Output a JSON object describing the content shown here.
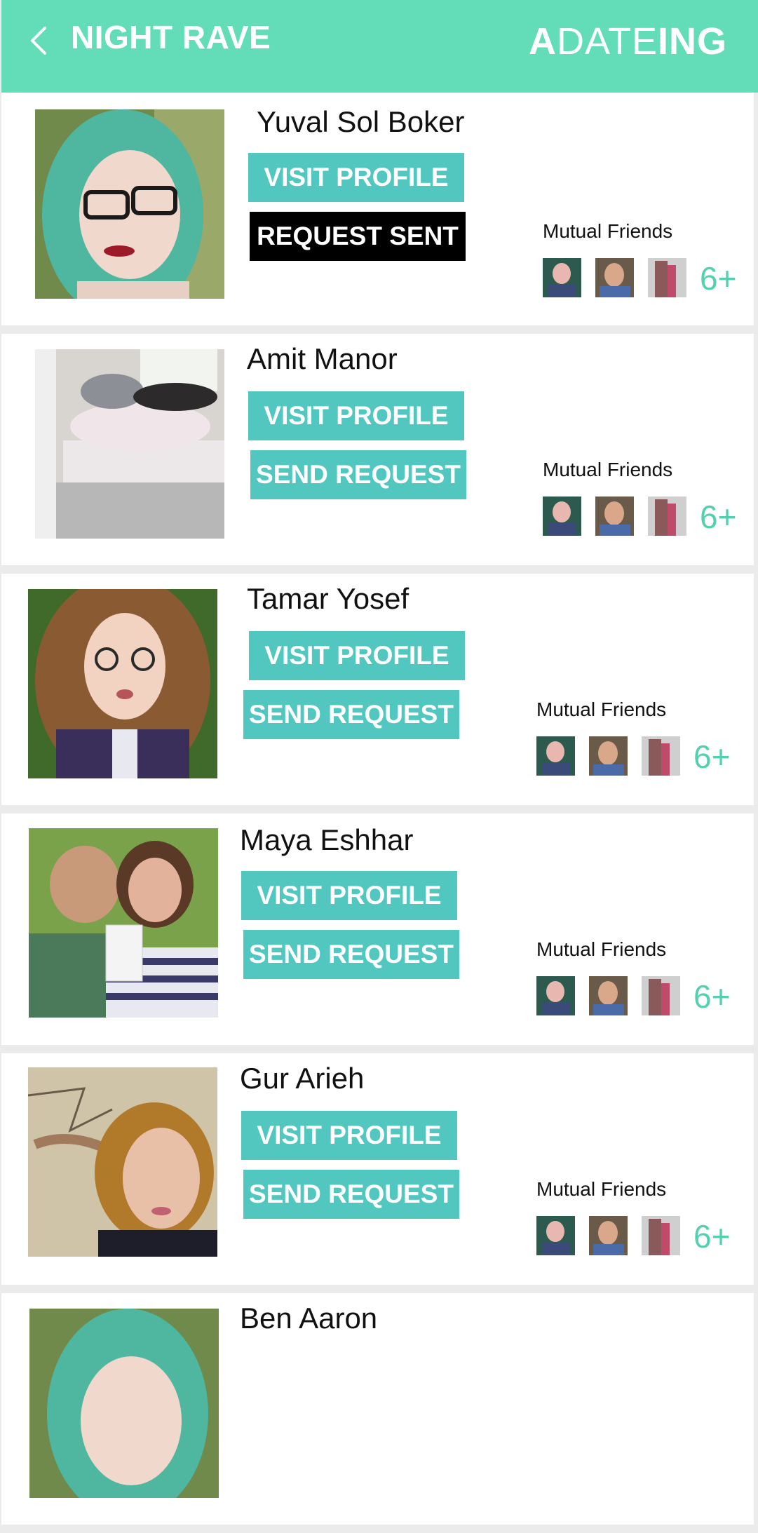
{
  "header": {
    "back_icon": "chevron-left-icon",
    "title": "NIGHT RAVE",
    "brand_a": "A",
    "brand_date": "DATE",
    "brand_ing": "ING"
  },
  "people": [
    {
      "name": "Yuval Sol Boker",
      "visit_label": "VISIT PROFILE",
      "request_label": "REQUEST SENT",
      "request_state": "sent",
      "mutual_label": "Mutual Friends",
      "mutual_more": "6+"
    },
    {
      "name": "Amit Manor",
      "visit_label": "VISIT PROFILE",
      "request_label": "SEND REQUEST",
      "request_state": "send",
      "mutual_label": "Mutual Friends",
      "mutual_more": "6+"
    },
    {
      "name": "Tamar Yosef",
      "visit_label": "VISIT PROFILE",
      "request_label": "SEND REQUEST",
      "request_state": "send",
      "mutual_label": "Mutual Friends",
      "mutual_more": "6+"
    },
    {
      "name": "Maya Eshhar",
      "visit_label": "VISIT PROFILE",
      "request_label": "SEND REQUEST",
      "request_state": "send",
      "mutual_label": "Mutual Friends",
      "mutual_more": "6+"
    },
    {
      "name": "Gur Arieh",
      "visit_label": "VISIT PROFILE",
      "request_label": "SEND REQUEST",
      "request_state": "send",
      "mutual_label": "Mutual Friends",
      "mutual_more": "6+"
    },
    {
      "name": "Ben Aaron"
    }
  ],
  "colors": {
    "header_bg": "#63ddb8",
    "button_bg": "#52c7bf",
    "button_sent_bg": "#000000",
    "count_color": "#52d0b0"
  }
}
